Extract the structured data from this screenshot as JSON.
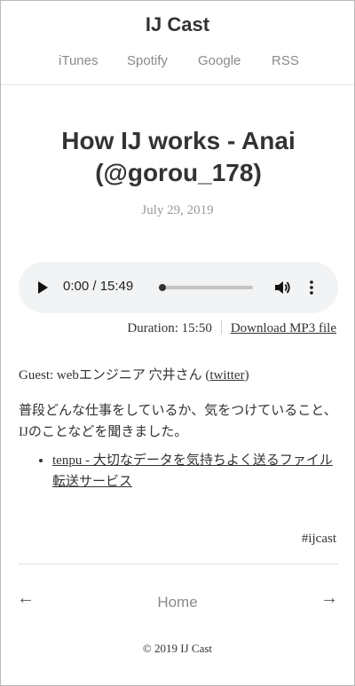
{
  "site": {
    "title": "IJ Cast"
  },
  "nav": [
    "iTunes",
    "Spotify",
    "Google",
    "RSS"
  ],
  "post": {
    "title": "How IJ works - Anai (@gorou_178)",
    "date": "July 29, 2019"
  },
  "player": {
    "time": "0:00 / 15:49",
    "progress": 0
  },
  "meta": {
    "duration": "Duration: 15:50",
    "download": "Download MP3 file"
  },
  "guest": {
    "prefix": "Guest: webエンジニア 穴井さん (",
    "link": "twitter",
    "suffix": ")"
  },
  "description": "普段どんな仕事をしているか、気をつけていること、IJのことなどを聞きました。",
  "links": [
    "tenpu - 大切なデータを気持ちよく送るファイル転送サービス"
  ],
  "tag": "#ijcast",
  "pager": {
    "prev": "←",
    "home": "Home",
    "next": "→"
  },
  "footer": "© 2019 IJ Cast"
}
